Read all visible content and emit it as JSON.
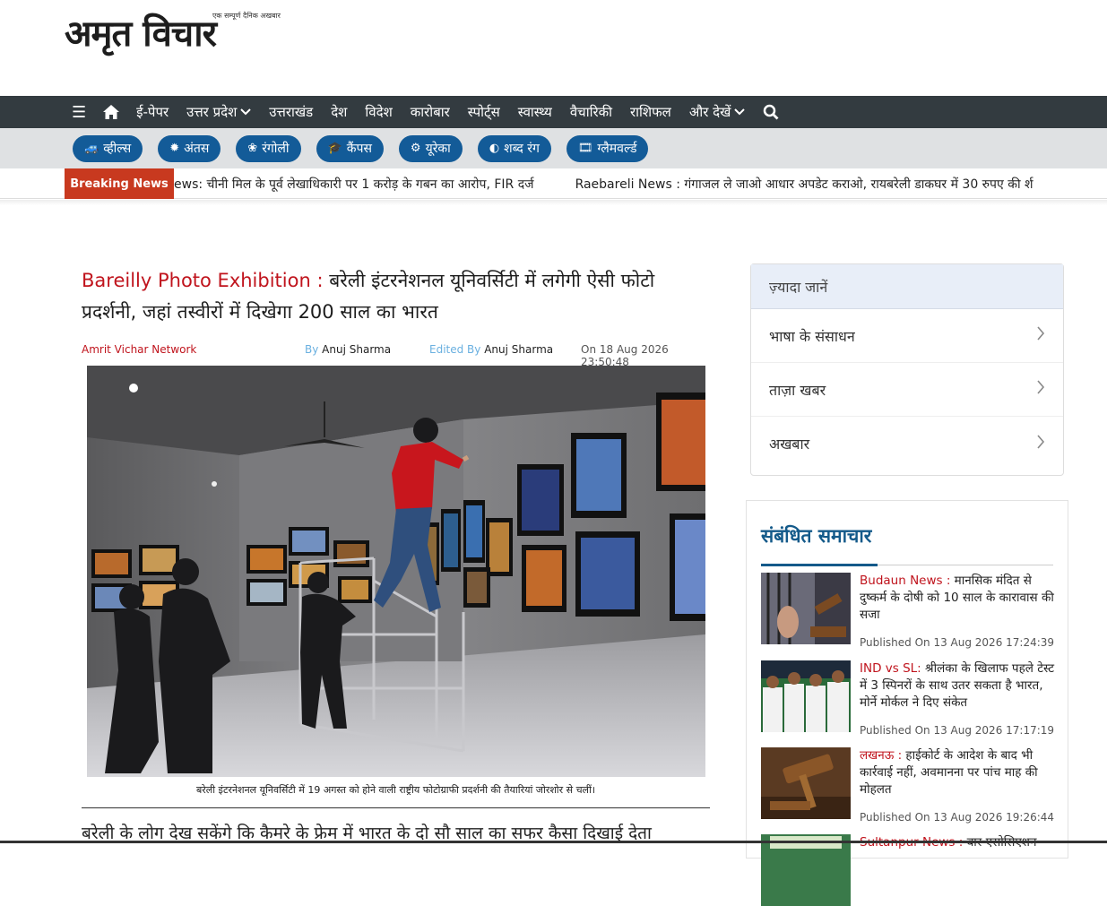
{
  "logo": {
    "tagline": "एक सम्पूर्ण दैनिक अखबार",
    "name": "अमृत विचार"
  },
  "nav": {
    "items": [
      {
        "label": "ई-पेपर",
        "dropdown": false
      },
      {
        "label": "उत्तर प्रदेश",
        "dropdown": true
      },
      {
        "label": "उत्तराखंड",
        "dropdown": false
      },
      {
        "label": "देश",
        "dropdown": false
      },
      {
        "label": "विदेश",
        "dropdown": false
      },
      {
        "label": "कारोबार",
        "dropdown": false
      },
      {
        "label": "स्पोर्ट्स",
        "dropdown": false
      },
      {
        "label": "स्वास्थ्य",
        "dropdown": false
      },
      {
        "label": "वैचारिकी",
        "dropdown": false
      },
      {
        "label": "राशिफल",
        "dropdown": false
      },
      {
        "label": "और देखें",
        "dropdown": true
      }
    ]
  },
  "subnav": {
    "pills": [
      {
        "label": "व्हील्स",
        "icon": "car-icon",
        "glyph": "🚙"
      },
      {
        "label": "अंतस",
        "icon": "sun-icon",
        "glyph": "✹"
      },
      {
        "label": "रंगोली",
        "icon": "lotus-icon",
        "glyph": "❀"
      },
      {
        "label": "कैंपस",
        "icon": "graduation-cap-icon",
        "glyph": "🎓"
      },
      {
        "label": "यूरेका",
        "icon": "gear-icon",
        "glyph": "⚙"
      },
      {
        "label": "शब्द रंग",
        "icon": "palette-icon",
        "glyph": "◐"
      },
      {
        "label": "ग्लैमवर्ल्ड",
        "icon": "film-icon",
        "glyph": "🎞"
      }
    ]
  },
  "breaking": {
    "label": "Breaking News",
    "items": [
      {
        "text": "ews: चीनी मिल के पूर्व लेखाधिकारी पर 1 करोड़ के गबन का आरोप, FIR दर्ज"
      },
      {
        "text": "Raebareli News : गंगाजल ले जाओ आधार अपडेट कराओ, रायबरेली डाकघर में 30 रुपए की र्श"
      }
    ]
  },
  "article": {
    "headline_kw": "Bareilly Photo Exhibition :",
    "headline_rest": " बरेली इंटरनेशनल यूनिवर्सिटी में लगेगी ऐसी फोटो प्रदर्शनी, जहां तस्वीरों में दिखेगा 200 साल का भारत",
    "agency": "Amrit Vichar Network",
    "by_label": "By",
    "author": "Anuj Sharma",
    "edited_label": "Edited By",
    "editor": "Anuj Sharma",
    "date": "On 18 Aug 2026 23:50:48",
    "caption": "बरेली इंटरनेशनल यूनिवर्सिटी में 19 अगस्त को होने वाली राष्ट्रीय फोटोग्राफी प्रदर्शनी की तैयारियां जोरशोर से चलीं।",
    "lead": "बरेली के लोग देख सकेंगे कि कैमरे के फ्रेम में भारत के दो सौ साल का सफर कैसा दिखाई देता"
  },
  "sidebar": {
    "title": "ज़्यादा जानें",
    "rows": [
      {
        "label": "भाषा के संसाधन"
      },
      {
        "label": "ताज़ा खबर"
      },
      {
        "label": "अखबार"
      }
    ]
  },
  "related": {
    "title": "संबंधित समाचार",
    "items": [
      {
        "kw": "Budaun News :",
        "text": " मानसिक मंदित से दुष्कर्म के दोषी को 10 साल के कारावास की सजा",
        "date": "Published On 13 Aug 2026 17:24:39"
      },
      {
        "kw": "IND vs SL:",
        "text": " श्रीलंका के खिलाफ पहले टेस्ट में 3 स्पिनरों के साथ उतर सकता है भारत, मोर्ने मोर्कल ने दिए संकेत",
        "date": "Published On 13 Aug 2026 17:17:19"
      },
      {
        "kw": "लखनऊ :",
        "text": " हाईकोर्ट के आदेश के बाद भी कार्रवाई नहीं, अवमानना पर पांच माह की मोहलत",
        "date": "Published On 13 Aug 2026 19:26:44"
      },
      {
        "kw": "Sultanpur News :",
        "text": " बार एसोसिएशन",
        "date": ""
      }
    ]
  }
}
